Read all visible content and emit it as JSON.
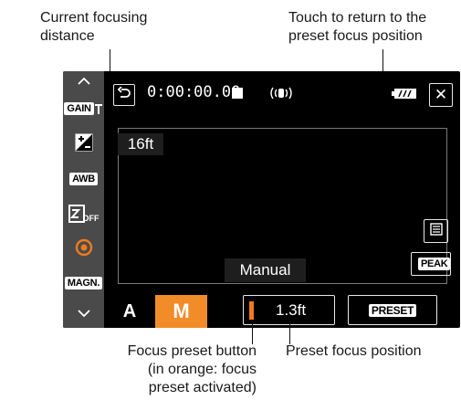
{
  "annotations": {
    "current_focusing_distance": [
      "Current focusing",
      "distance"
    ],
    "touch_to_return": [
      "Touch to return to the",
      "preset focus position"
    ],
    "focus_preset_button": [
      "Focus preset button",
      "(in orange: focus",
      "preset activated)"
    ],
    "preset_focus_position": "Preset focus position"
  },
  "sidebar": {
    "items": [
      {
        "icon": "chevron-up-icon",
        "label": "^"
      },
      {
        "icon": "gain-icon",
        "label": "GAIN"
      },
      {
        "icon": "exposure-icon",
        "label": "±"
      },
      {
        "icon": "awb-icon",
        "label": "AWB"
      },
      {
        "icon": "picture-off-icon",
        "label": "OFF"
      },
      {
        "icon": "focus-icon",
        "label": ""
      },
      {
        "icon": "magnification-icon",
        "label": "MAGN."
      },
      {
        "icon": "chevron-down-icon",
        "label": "v"
      }
    ]
  },
  "topbar": {
    "timecode": "0:00:00.00",
    "record_state": "stop-square",
    "stabilizer": "(( ))",
    "battery_icon": "battery-icon",
    "close_label": "✕",
    "back_icon": "back-arrow-icon"
  },
  "viewfinder": {
    "distance_readout": "16ft",
    "mode_label": "Manual"
  },
  "right_buttons": {
    "menu_icon": "list-icon",
    "peak_label": "PEAK"
  },
  "bottom_bar": {
    "auto_label": "A",
    "manual_label": "M",
    "preset_distance": "1.3ft",
    "preset_button_label": "PRESET"
  },
  "colors": {
    "accent_orange": "#f28c28",
    "focus_orange": "#f07a1e",
    "sidebar_bg": "#4a4a4a",
    "screen_bg": "#000000"
  }
}
